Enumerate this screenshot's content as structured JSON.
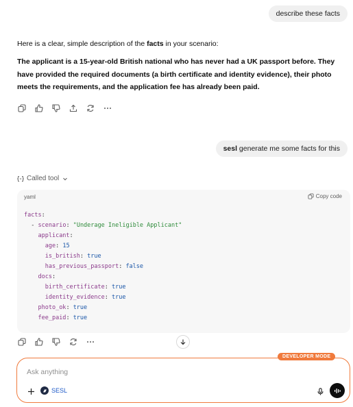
{
  "messages": {
    "user1": "describe these facts",
    "assistant_intro_pre": "Here is a clear, simple description of the ",
    "assistant_intro_bold": "facts",
    "assistant_intro_post": " in your scenario:",
    "assistant_body": "The applicant is a 15-year-old British national who has never had a UK passport before. They have provided the required documents (a birth certificate and identity evidence), their photo meets the requirements, and the application fee has already been paid.",
    "user2_bold": "sesl",
    "user2_rest": " generate me some facts for this"
  },
  "tool_call": {
    "label": "Called tool",
    "code_lang": "yaml",
    "copy_label": "Copy code",
    "code": [
      {
        "indent": "",
        "key": "facts",
        "value": "",
        "vtype": ""
      },
      {
        "indent": "  ",
        "dash": "- ",
        "key": "scenario",
        "value": "\"Underage Ineligible Applicant\"",
        "vtype": "s"
      },
      {
        "indent": "    ",
        "key": "applicant",
        "value": "",
        "vtype": ""
      },
      {
        "indent": "      ",
        "key": "age",
        "value": "15",
        "vtype": "v"
      },
      {
        "indent": "      ",
        "key": "is_british",
        "value": "true",
        "vtype": "v"
      },
      {
        "indent": "      ",
        "key": "has_previous_passport",
        "value": "false",
        "vtype": "v"
      },
      {
        "indent": "    ",
        "key": "docs",
        "value": "",
        "vtype": ""
      },
      {
        "indent": "      ",
        "key": "birth_certificate",
        "value": "true",
        "vtype": "v"
      },
      {
        "indent": "      ",
        "key": "identity_evidence",
        "value": "true",
        "vtype": "v"
      },
      {
        "indent": "    ",
        "key": "photo_ok",
        "value": "true",
        "vtype": "v"
      },
      {
        "indent": "    ",
        "key": "fee_paid",
        "value": "true",
        "vtype": "v"
      }
    ]
  },
  "composer": {
    "badge": "DEVELOPER MODE",
    "placeholder": "Ask anything",
    "tool_label": "SESL"
  },
  "colors": {
    "accent": "#f07a3c",
    "link": "#1e5ac8"
  }
}
